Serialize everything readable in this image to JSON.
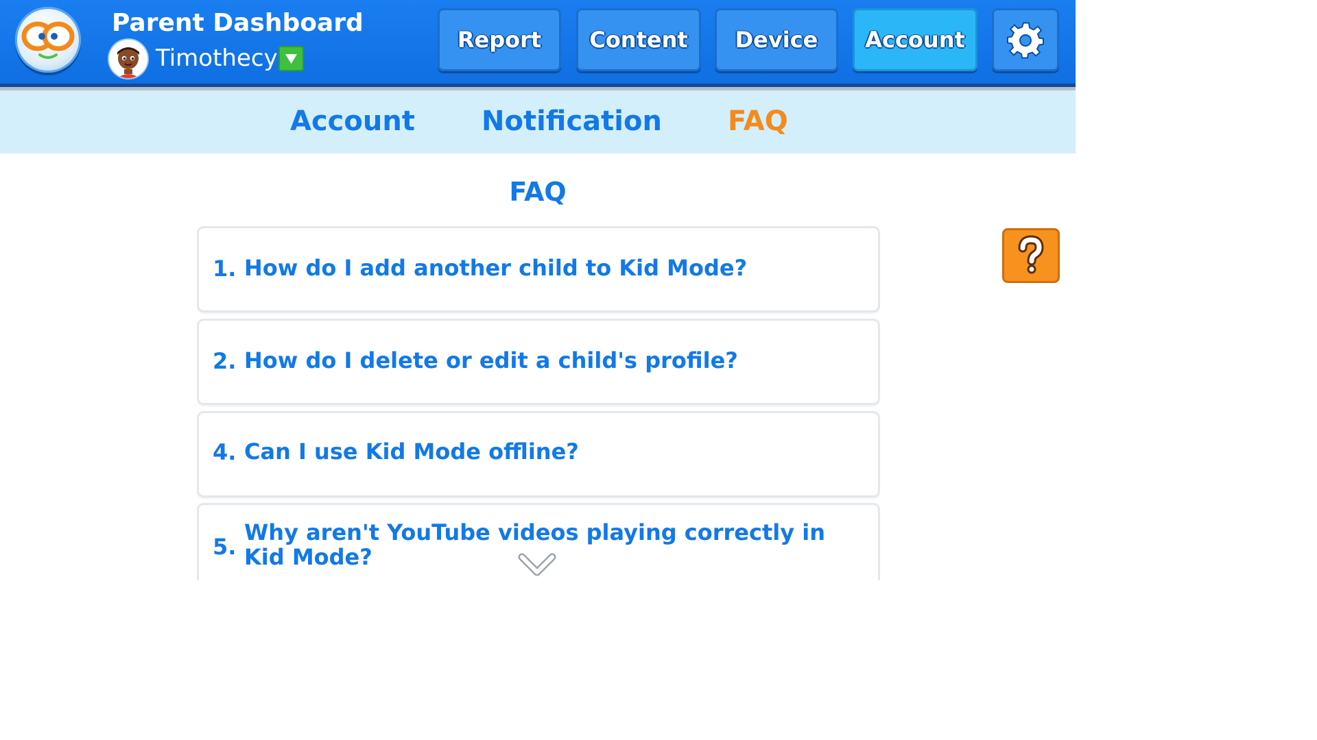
{
  "header": {
    "title": "Parent Dashboard",
    "child_name": "Timothecy",
    "dropdown_icon": "triangle-down-icon",
    "nav": [
      {
        "label": "Report",
        "active": false
      },
      {
        "label": "Content",
        "active": false
      },
      {
        "label": "Device",
        "active": false
      },
      {
        "label": "Account",
        "active": true
      }
    ],
    "settings_icon": "gear-icon"
  },
  "subtabs": [
    {
      "label": "Account",
      "active": false
    },
    {
      "label": "Notification",
      "active": false
    },
    {
      "label": "FAQ",
      "active": true
    }
  ],
  "main": {
    "title": "FAQ",
    "faqs": [
      {
        "number": "1.",
        "question": "How do I add another child to Kid Mode?"
      },
      {
        "number": "2.",
        "question": "How do I delete or edit a child's profile?"
      },
      {
        "number": "4.",
        "question": "Can I use Kid Mode offline?"
      },
      {
        "number": "5.",
        "question": "Why aren't YouTube videos playing correctly in Kid Mode?"
      }
    ],
    "scroll_icon": "chevron-down-icon"
  },
  "help_icon": "question-mark-icon",
  "colors": {
    "header_blue": "#1477ea",
    "accent_blue": "#1279e8",
    "active_orange": "#f38b1c",
    "subtab_bg": "#d4effc",
    "dropdown_green": "#3fbf3f",
    "help_orange": "#f7921e"
  }
}
